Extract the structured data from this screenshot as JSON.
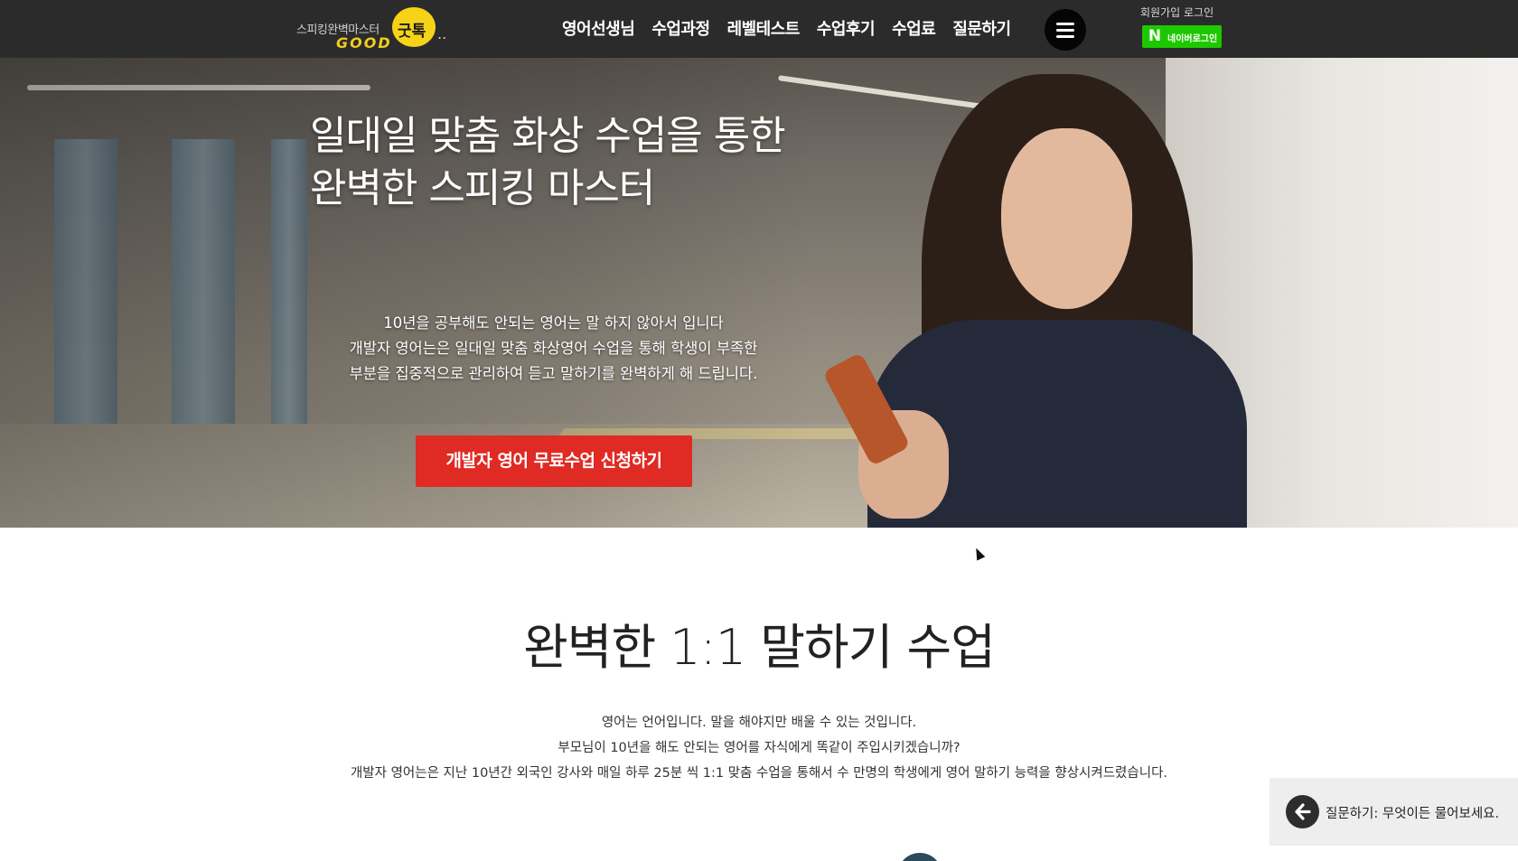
{
  "header": {
    "logo": {
      "tagline": "스피킹완벽마스터",
      "good": "GOOD",
      "bubble_text": "굿톡",
      "dots": ".."
    },
    "nav": [
      "영어선생님",
      "수업과정",
      "레벨테스트",
      "수업후기",
      "수업료",
      "질문하기"
    ],
    "menu_icon": "hamburger-menu-icon",
    "auth": {
      "signup": "회원가입",
      "login": "로그인"
    },
    "naver_login": {
      "icon_letter": "N",
      "label": "네이버로그인",
      "color": "#1ec800"
    }
  },
  "hero": {
    "title_lines": [
      "일대일 맞춤 화상 수업을 통한",
      "완벽한 스피킹 마스터"
    ],
    "desc_lines": [
      "10년을 공부해도 안되는 영어는 말 하지 않아서 입니다",
      "개발자 영어는은 일대일 맞춤 화상영어 수업을 통해 학생이 부족한",
      "부분을 집중적으로 관리하여 듣고 말하기를 완벽하게 해 드립니다."
    ],
    "cta_label": "개발자 영어 무료수업 신청하기",
    "cta_color": "#e02a24"
  },
  "section": {
    "title": "완벽한 1:1 말하기 수업",
    "desc_lines": [
      "영어는 언어입니다. 말을 해야지만 배울 수 있는 것입니다.",
      "부모님이 10년을 해도 안되는 영어를 자식에게 똑같이 주입시키겠습니까?",
      "개발자 영어는은 지난 10년간 외국인 강사와 매일 하루 25분 씩 1:1 맞춤 수업을 통해서 수 만명의 학생에게 영어 말하기 능력을 향상시켜드렸습니다."
    ]
  },
  "question_widget": {
    "icon": "arrow-left-icon",
    "text": "질문하기: 무엇이든 물어보세요."
  }
}
